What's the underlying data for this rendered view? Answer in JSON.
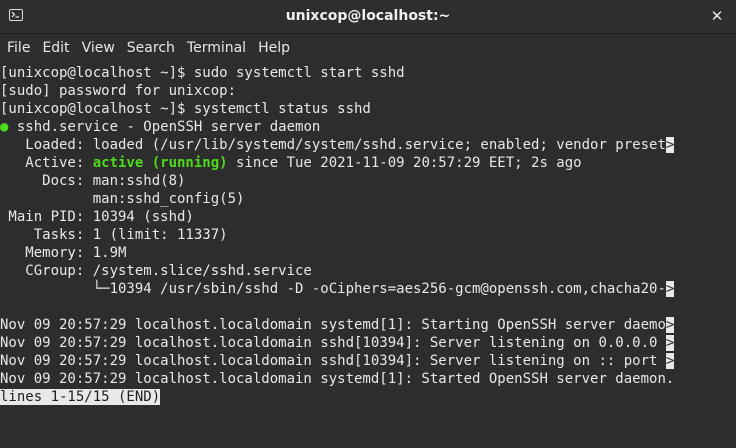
{
  "window": {
    "title": "unixcop@localhost:~",
    "icon": "terminal-icon",
    "close_label": "✕"
  },
  "menu": [
    "File",
    "Edit",
    "View",
    "Search",
    "Terminal",
    "Help"
  ],
  "colors": {
    "background": "#2d2d2d",
    "text": "#e8e8e8",
    "accent_green": "#4edb1b"
  },
  "terminal": {
    "lines": [
      {
        "text": "[unixcop@localhost ~]$ sudo systemctl start sshd"
      },
      {
        "text": "[sudo] password for unixcop:"
      },
      {
        "text": "[unixcop@localhost ~]$ systemctl status sshd"
      },
      {
        "dot": "●",
        "text": " sshd.service - OpenSSH server daemon"
      },
      {
        "text": "   Loaded: loaded (/usr/lib/systemd/system/sshd.service; enabled; vendor preset",
        "trunc": ">"
      },
      {
        "pre": "   Active: ",
        "green": "active (running)",
        "text": " since Tue 2021-11-09 20:57:29 EET; 2s ago"
      },
      {
        "text": "     Docs: man:sshd(8)"
      },
      {
        "text": "           man:sshd_config(5)"
      },
      {
        "text": " Main PID: 10394 (sshd)"
      },
      {
        "text": "    Tasks: 1 (limit: 11337)"
      },
      {
        "text": "   Memory: 1.9M"
      },
      {
        "text": "   CGroup: /system.slice/sshd.service"
      },
      {
        "text": "           └─10394 /usr/sbin/sshd -D -oCiphers=aes256-gcm@openssh.com,chacha20-",
        "trunc": ">"
      },
      {
        "text": ""
      },
      {
        "text": "Nov 09 20:57:29 localhost.localdomain systemd[1]: Starting OpenSSH server daemo",
        "trunc": ">"
      },
      {
        "text": "Nov 09 20:57:29 localhost.localdomain sshd[10394]: Server listening on 0.0.0.0 ",
        "trunc": ">"
      },
      {
        "text": "Nov 09 20:57:29 localhost.localdomain sshd[10394]: Server listening on :: port ",
        "trunc": ">"
      },
      {
        "text": "Nov 09 20:57:29 localhost.localdomain systemd[1]: Started OpenSSH server daemon."
      }
    ],
    "pager_status": "lines 1-15/15 (END)"
  }
}
